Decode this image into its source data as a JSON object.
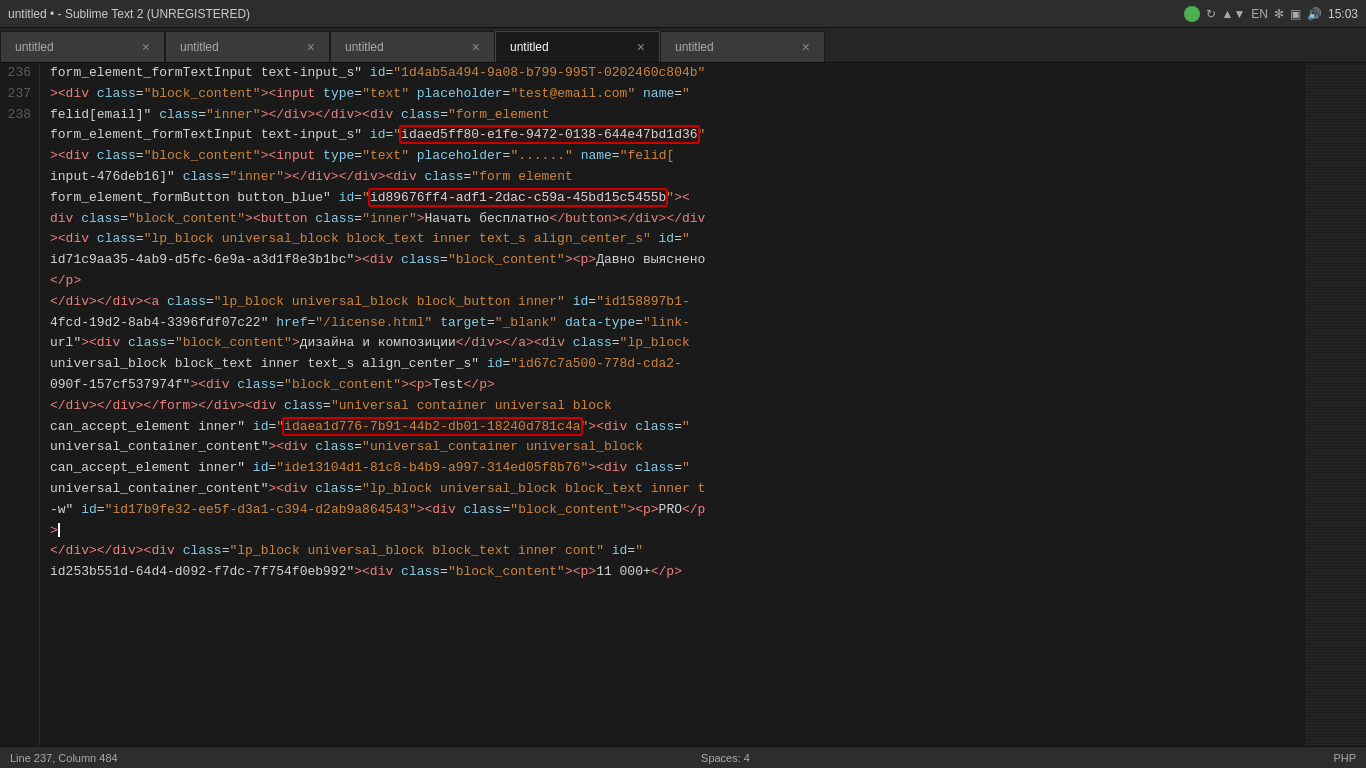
{
  "titleBar": {
    "title": "untitled • - Sublime Text 2 (UNREGISTERED)",
    "time": "15:03",
    "statusGreen": true,
    "sysIcons": [
      "EN",
      "⊹",
      "◈",
      "🔊"
    ]
  },
  "tabs": [
    {
      "label": "untitled",
      "active": false
    },
    {
      "label": "untitled",
      "active": false
    },
    {
      "label": "untitled",
      "active": false
    },
    {
      "label": "untitled",
      "active": true
    },
    {
      "label": "untitled",
      "active": false
    }
  ],
  "statusBar": {
    "position": "Line 237, Column 484",
    "spaces": "Spaces: 4",
    "filetype": "PHP"
  },
  "lines": [
    {
      "num": "",
      "content": "form_element_formTextInput text-input_s\" id=\"1d4ab5a494-9a08-b799-995T-0202460c804b\""
    },
    {
      "num": "",
      "content": "><div class=\"block_content\"><input type=\"text\" placeholder=\"test@email.com\" name=\""
    },
    {
      "num": "",
      "content": "felid[email]\" class=\"inner\"></div></div><div class=\"form_element"
    },
    {
      "num": "",
      "content": "form_element_formTextInput text-input_s\" id=\"idaed5ff80-e1fe-9472-0138-644e47bd1d36\"",
      "highlight": "idaed5ff80-e1fe-9472-0138-644e47bd1d36"
    },
    {
      "num": "",
      "content": "><div class=\"block_content\"><input type=\"text\" placeholder=\"......\" name=\"felid["
    },
    {
      "num": "",
      "content": "input-476deb16]\" class=\"inner\"></div></div><div class=\"form element"
    },
    {
      "num": "",
      "content": "form_element_formButton button_blue\" id=\"id89676ff4-adf1-2dac-c59a-45bd15c5455b\"><",
      "highlight": "id89676ff4-adf1-2dac-c59a-45bd15c5455b"
    },
    {
      "num": "",
      "content": "div class=\"block_content\"><button class=\"inner\">Начать бесплатно</button></div></div"
    },
    {
      "num": "",
      "content": "><div class=\"lp_block universal_block block_text inner text_s align_center_s\" id=\""
    },
    {
      "num": "",
      "content": "id71c9aa35-4ab9-d5fc-6e9a-a3d1f8e3b1bc\"><div class=\"block_content\"><p>Давно выяснено"
    },
    {
      "num": "236",
      "content": "</p>"
    },
    {
      "num": "",
      "content": "</div></div><a class=\"lp_block universal_block block_button inner\" id=\"id158897b1-"
    },
    {
      "num": "",
      "content": "4fcd-19d2-8ab4-3396fdf07c22\" href=\"/license.html\" target=\"_blank\" data-type=\"link-"
    },
    {
      "num": "",
      "content": "url\"><div class=\"block_content\">дизайна и композиции</div></a><div class=\"lp_block"
    },
    {
      "num": "",
      "content": "universal_block block_text inner text_s align_center_s\" id=\"id67c7a500-778d-cda2-"
    },
    {
      "num": "",
      "content": "090f-157cf537974f\"><div class=\"block_content\"><p>Test</p>"
    },
    {
      "num": "237",
      "content": "</div></div></form></div><div class=\"universal container universal block"
    },
    {
      "num": "",
      "content": "can_accept_element inner\" id=\"idaea1d776-7b91-44b2-db01-18240d781c4a\"><div class=\"",
      "highlight2": "idaea1d776-7b91-44b2-db01-18240d781c4a"
    },
    {
      "num": "",
      "content": "universal_container_content\"><div class=\"universal_container universal_block"
    },
    {
      "num": "",
      "content": "can_accept_element inner\" id=\"ide13104d1-81c8-b4b9-a997-314ed05f8b76\"><div class=\""
    },
    {
      "num": "",
      "content": "universal_container_content\"><div class=\"lp_block universal_block block_text inner t"
    },
    {
      "num": "",
      "content": "-w\" id=\"id17b9fe32-ee5f-d3a1-c394-d2ab9a864543\"><div class=\"block_content\"><p>PRO</p"
    },
    {
      "num": "",
      "content": ">"
    },
    {
      "num": "238",
      "content": "</div></div><div class=\"lp_block universal_block block_text inner cont\" id=\""
    },
    {
      "num": "",
      "content": "id253b551d-64d4-d092-f7dc-7f754f0eb992\"><div class=\"block_content\"><p>11 000+</p>"
    }
  ]
}
